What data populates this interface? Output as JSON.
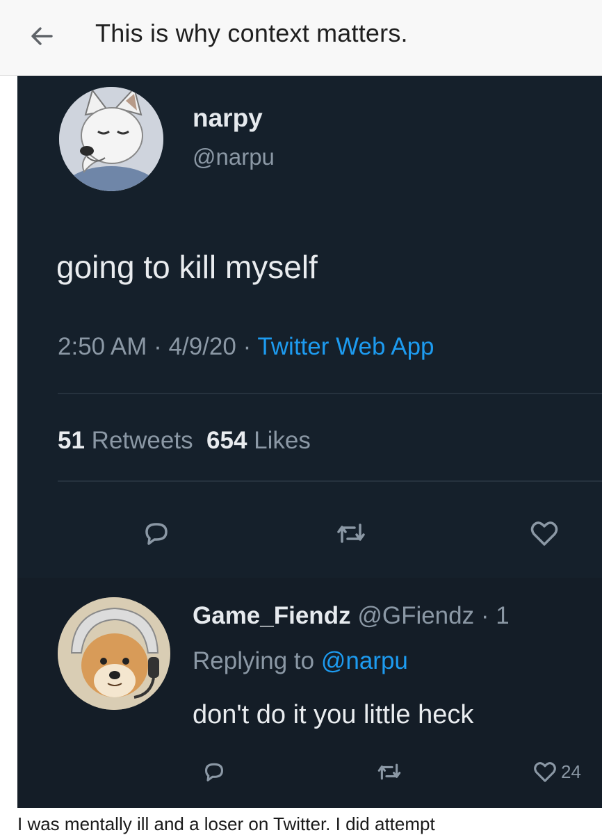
{
  "header": {
    "title": "This is why context matters.",
    "back_icon": "arrow-left-icon"
  },
  "tweet": {
    "display_name": "narpy",
    "handle": "@narpu",
    "text": "going to kill myself",
    "time": "2:50 AM",
    "sep1": " · ",
    "date": "4/9/20",
    "sep2": " · ",
    "source": "Twitter Web App",
    "retweets_count": "51",
    "retweets_label": "Retweets",
    "likes_count": "654",
    "likes_label": "Likes",
    "icons": [
      "reply-icon",
      "retweet-icon",
      "like-icon"
    ]
  },
  "reply": {
    "display_name": "Game_Fiendz",
    "handle_time": "@GFiendz · 1",
    "replying_prefix": "Replying to ",
    "replying_to": "@narpu",
    "text": "don't do it you little heck",
    "like_count": "24",
    "icons": [
      "reply-icon",
      "retweet-icon",
      "like-icon"
    ]
  },
  "caption": {
    "text": "I was mentally ill and a loser on Twitter. I did attempt"
  },
  "colors": {
    "tweet_bg": "#15202b",
    "link_blue": "#1d9bf0",
    "muted_text": "#8b98a5"
  }
}
